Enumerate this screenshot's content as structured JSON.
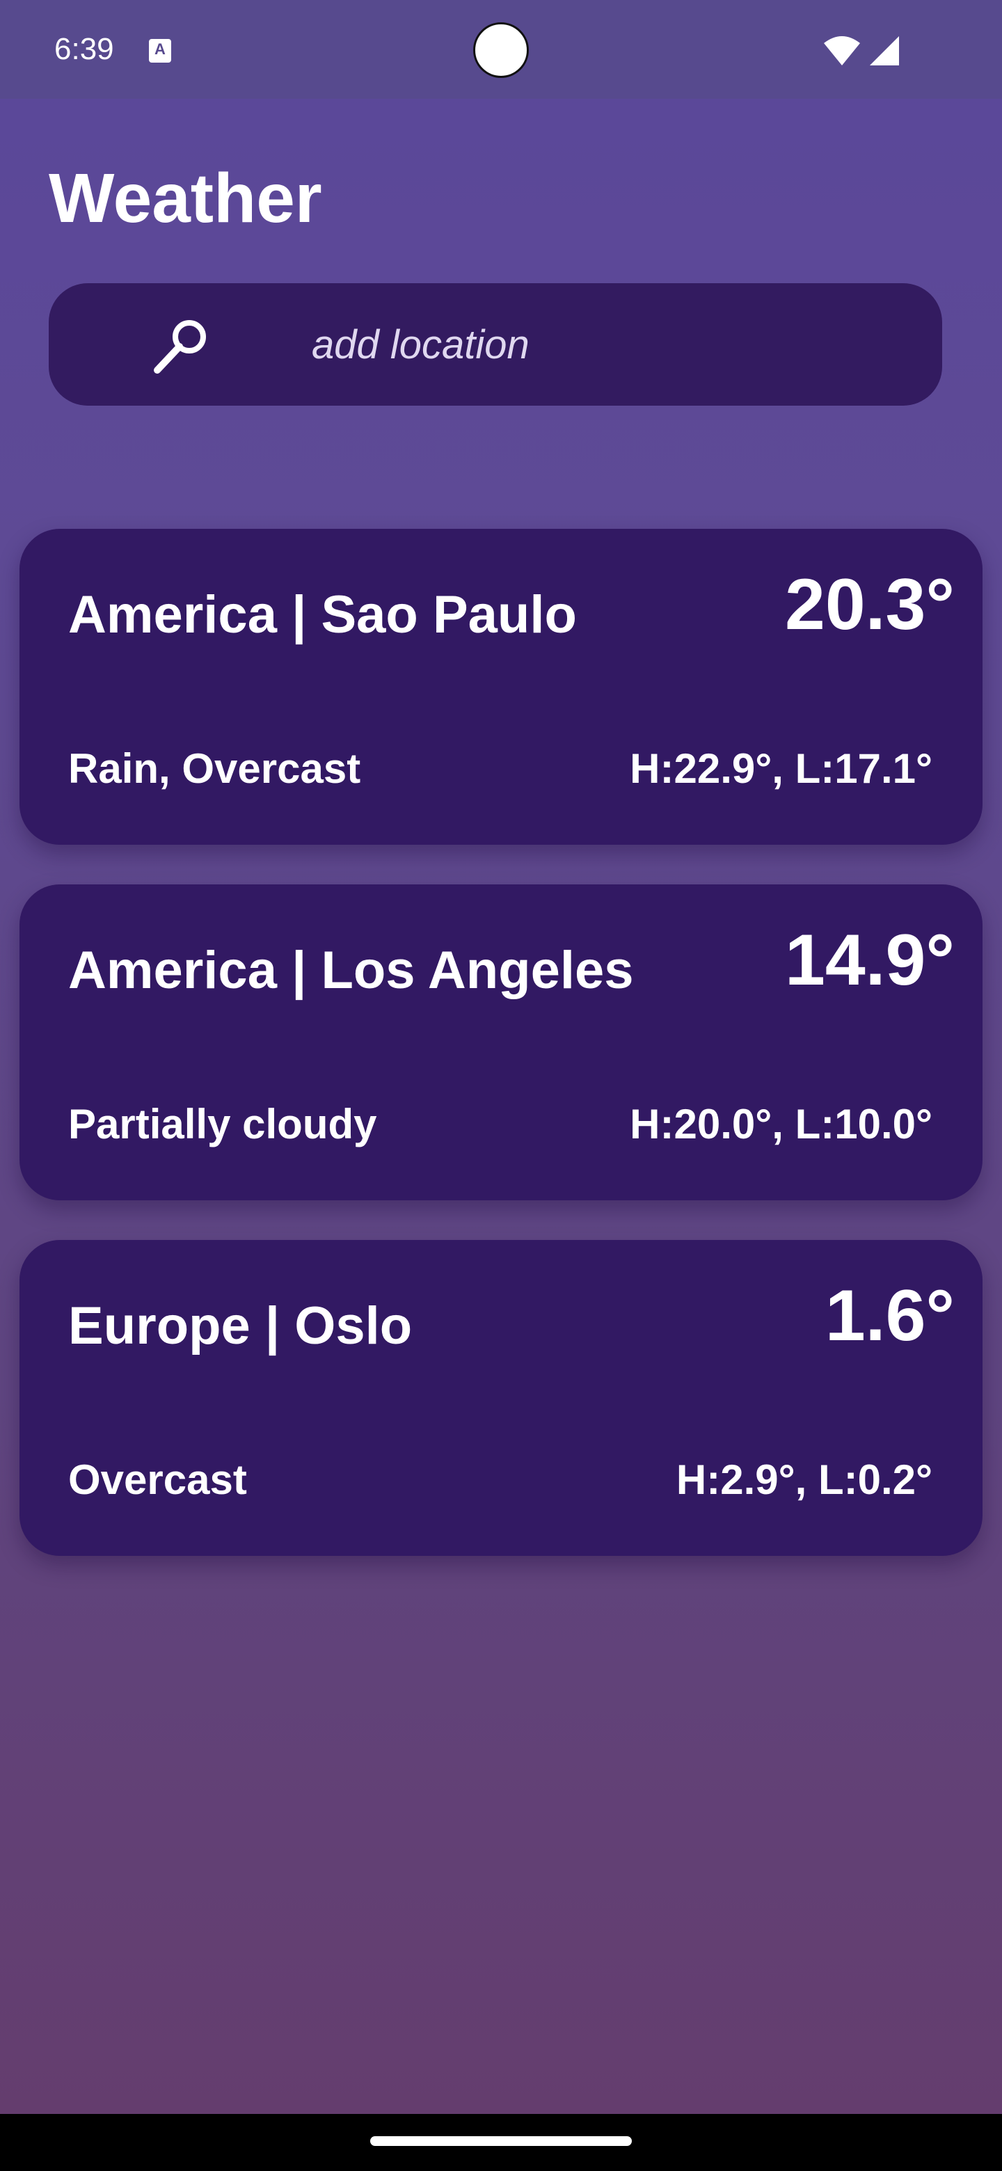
{
  "status_bar": {
    "time": "6:39",
    "notification_icon_letter": "A",
    "icons": [
      "a-notification-icon",
      "wifi-icon",
      "cell-signal-icon"
    ]
  },
  "header": {
    "title": "Weather"
  },
  "search": {
    "placeholder": "add location",
    "icon": "search-icon"
  },
  "locations": [
    {
      "name": "America | Sao Paulo",
      "temperature": "20.3°",
      "condition": "Rain, Overcast",
      "high_low": "H:22.9°, L:17.1°"
    },
    {
      "name": "America | Los Angeles",
      "temperature": "14.9°",
      "condition": "Partially cloudy",
      "high_low": "H:20.0°, L:10.0°"
    },
    {
      "name": "Europe | Oslo",
      "temperature": "1.6°",
      "condition": "Overcast",
      "high_low": "H:2.9°, L:0.2°"
    }
  ],
  "colors": {
    "background_top": "#5a479a",
    "background_bottom": "#643d6e",
    "card": "#321963",
    "search_bar": "#331b60",
    "text": "#ffffff"
  }
}
